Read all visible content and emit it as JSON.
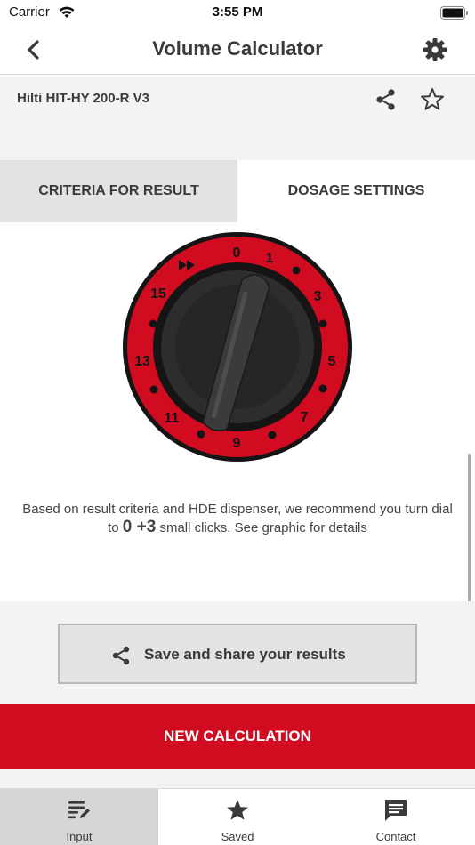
{
  "status_bar": {
    "carrier": "Carrier",
    "time": "3:55 PM"
  },
  "nav": {
    "title": "Volume Calculator",
    "back_icon": "chevron-left-icon",
    "settings_icon": "gear-icon"
  },
  "product": {
    "name": "Hilti HIT-HY 200-R V3",
    "share_icon": "share-icon",
    "favorite_icon": "star-outline-icon"
  },
  "tabs": [
    {
      "label": "CRITERIA FOR RESULT",
      "selected": false
    },
    {
      "label": "DOSAGE SETTINGS",
      "selected": true
    }
  ],
  "dial": {
    "numbers": [
      "0",
      "1",
      "3",
      "5",
      "7",
      "9",
      "11",
      "13",
      "15"
    ],
    "fast_forward_icon": "fast-forward-icon",
    "setting": 0,
    "colors": {
      "ring": "#d10c21",
      "knob": "#2b2b2b",
      "pointer": "#3b3b3b"
    }
  },
  "recommendation": {
    "prefix": "Based on result criteria and HDE dispenser, we recommend you turn dial to",
    "clicks": "0 +3",
    "suffix": "small clicks. See graphic for details"
  },
  "actions": {
    "save_share_label": "Save and share your results",
    "new_calculation_label": "NEW CALCULATION"
  },
  "bottom_tabs": [
    {
      "label": "Input",
      "icon": "edit-list-icon",
      "selected": true
    },
    {
      "label": "Saved",
      "icon": "star-icon",
      "selected": false
    },
    {
      "label": "Contact",
      "icon": "chat-icon",
      "selected": false
    }
  ],
  "colors": {
    "brand_red": "#d10c21",
    "band_gray": "#f4f3f1",
    "text_dark": "#3a3a3a"
  }
}
